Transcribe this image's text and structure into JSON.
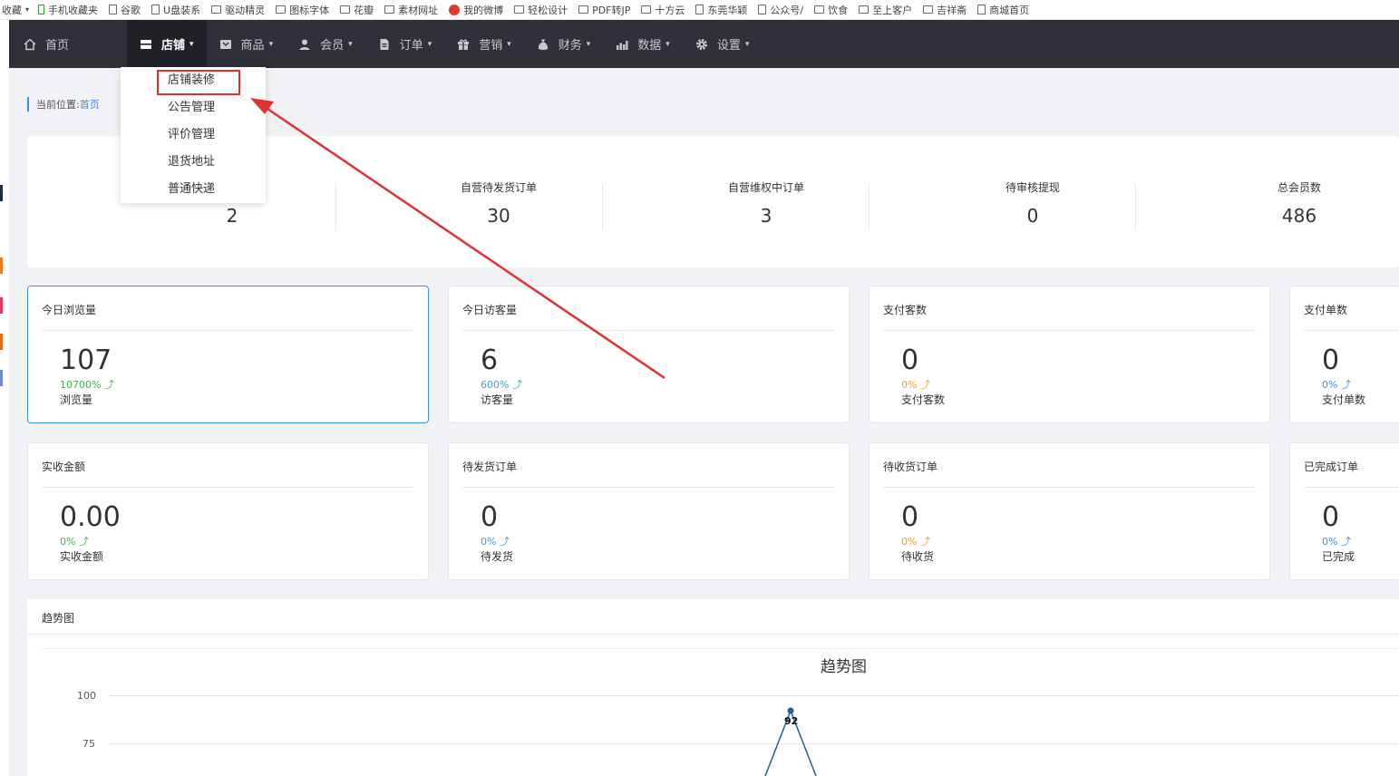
{
  "bookmarks": {
    "first": "收藏",
    "items": [
      "手机收藏夹",
      "谷歌",
      "U盘装系",
      "驱动精灵",
      "图标字体",
      "花瓣",
      "素材网址",
      "我的微博",
      "轻松设计",
      "PDF转JP",
      "十方云",
      "东莞华颖",
      "公众号/",
      "饮食",
      "至上客户",
      "吉祥斋",
      "商城首页"
    ]
  },
  "nav": {
    "items": [
      {
        "label": "首页",
        "icon": "home-icon"
      },
      {
        "label": "店铺",
        "icon": "store-icon"
      },
      {
        "label": "商品",
        "icon": "goods-icon"
      },
      {
        "label": "会员",
        "icon": "user-icon"
      },
      {
        "label": "订单",
        "icon": "order-icon"
      },
      {
        "label": "营销",
        "icon": "gift-icon"
      },
      {
        "label": "财务",
        "icon": "money-bag-icon"
      },
      {
        "label": "数据",
        "icon": "bar-chart-icon"
      },
      {
        "label": "设置",
        "icon": "gear-icon"
      }
    ]
  },
  "breadcrumb": {
    "prefix": "当前位置:",
    "link": "首页"
  },
  "dropdown": {
    "items": [
      "店铺装修",
      "公告管理",
      "评价管理",
      "退货地址",
      "普通快递"
    ]
  },
  "stats": [
    {
      "label": "",
      "value": "2",
      "color": "#fa7f5c",
      "icon": "bag-icon"
    },
    {
      "label": "自营待发货订单",
      "value": "30",
      "color": "#38b1f2",
      "icon": "truck-icon"
    },
    {
      "label": "自营维权中订单",
      "value": "3",
      "color": "#f6d91f",
      "icon": "edit-doc-icon"
    },
    {
      "label": "待审核提现",
      "value": "0",
      "color": "#15c47f",
      "icon": "search-doc-icon"
    },
    {
      "label": "总会员数",
      "value": "486",
      "color": "#fb8b3f",
      "icon": "members-icon"
    }
  ],
  "cards": [
    {
      "title": "今日浏览量",
      "value": "107",
      "pct": "10700%",
      "sub": "浏览量",
      "pct_color": "#3bb54a"
    },
    {
      "title": "今日访客量",
      "value": "6",
      "pct": "600%",
      "sub": "访客量",
      "pct_color": "#3aa3d8"
    },
    {
      "title": "支付客数",
      "value": "0",
      "pct": "0%",
      "sub": "支付客数",
      "pct_color": "#f0a31d"
    },
    {
      "title": "支付单数",
      "value": "0",
      "pct": "0%",
      "sub": "支付单数",
      "pct_color": "#3a8ee6"
    },
    {
      "title": "实收金额",
      "value": "0.00",
      "pct": "0%",
      "sub": "实收金额",
      "pct_color": "#3bb54a"
    },
    {
      "title": "待发货订单",
      "value": "0",
      "pct": "0%",
      "sub": "待发货",
      "pct_color": "#3aa3d8"
    },
    {
      "title": "待收货订单",
      "value": "0",
      "pct": "0%",
      "sub": "待收货",
      "pct_color": "#f0a31d"
    },
    {
      "title": "已完成订单",
      "value": "0",
      "pct": "0%",
      "sub": "已完成",
      "pct_color": "#3a8ee6"
    }
  ],
  "trend": {
    "section_title": "趋势图"
  },
  "chart_data": {
    "type": "line",
    "title": "趋势图",
    "y_ticks": [
      "100",
      "75"
    ],
    "ylim": [
      0,
      100
    ],
    "visible_points": [
      {
        "value": 92,
        "label": "92"
      }
    ],
    "line_color": "#1f5f9c",
    "grid": true
  }
}
